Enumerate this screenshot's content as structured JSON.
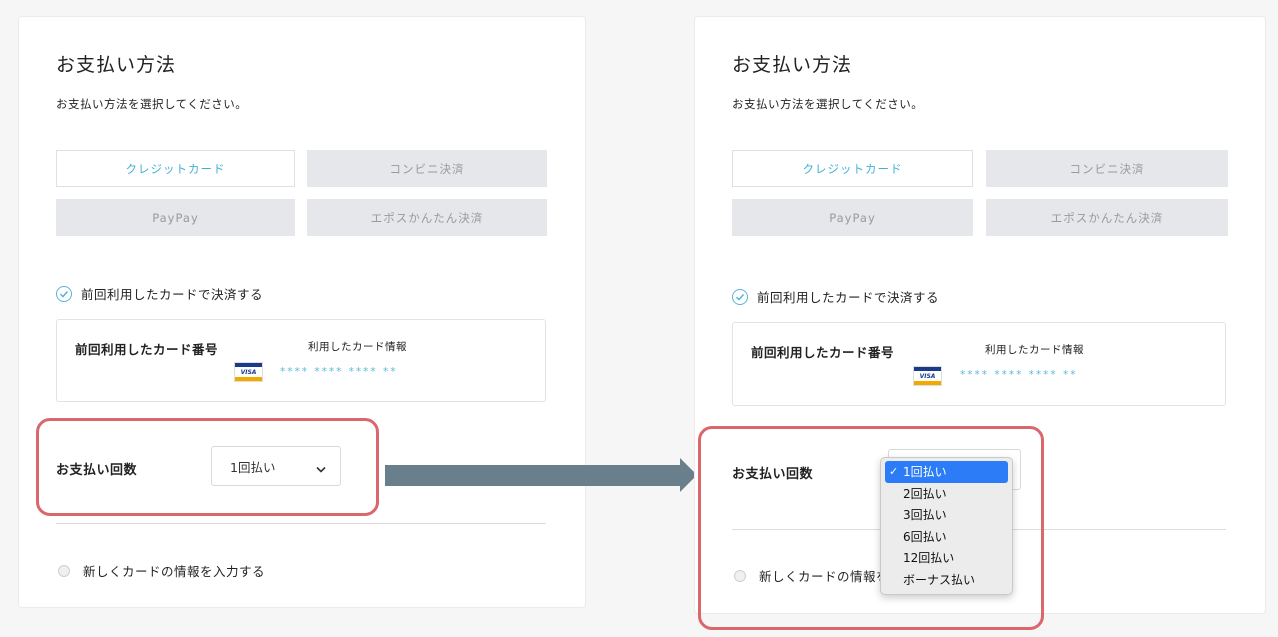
{
  "left": {
    "title": "お支払い方法",
    "subtitle": "お支払い方法を選択してください。",
    "methods": [
      "クレジットカード",
      "コンビニ決済",
      "PayPay",
      "エポスかんたん決済"
    ],
    "use_previous_card": "前回利用したカードで決済する",
    "previous_card_label": "前回利用したカード番号",
    "card_info_label": "利用したカード情報",
    "card_brand": "VISA",
    "card_number": "**** **** **** **",
    "installments_label": "お支払い回数",
    "installments_value": "1回払い",
    "new_card": "新しくカードの情報を入力する"
  },
  "right": {
    "title": "お支払い方法",
    "subtitle": "お支払い方法を選択してください。",
    "methods": [
      "クレジットカード",
      "コンビニ決済",
      "PayPay",
      "エポスかんたん決済"
    ],
    "use_previous_card": "前回利用したカードで決済する",
    "previous_card_label": "前回利用したカード番号",
    "card_info_label": "利用したカード情報",
    "card_brand": "VISA",
    "card_number": "**** **** **** **",
    "installments_label": "お支払い回数",
    "new_card": "新しくカードの情報を入力する",
    "dropdown_options": [
      "1回払い",
      "2回払い",
      "3回払い",
      "6回払い",
      "12回払い",
      "ボーナス払い"
    ],
    "dropdown_selected_index": 0,
    "dropdown_check": "✓"
  },
  "colors": {
    "accent": "#3fb1d4",
    "highlight": "#d9676c",
    "arrow": "#69808c",
    "dropdown_selected": "#2b7cf6"
  }
}
